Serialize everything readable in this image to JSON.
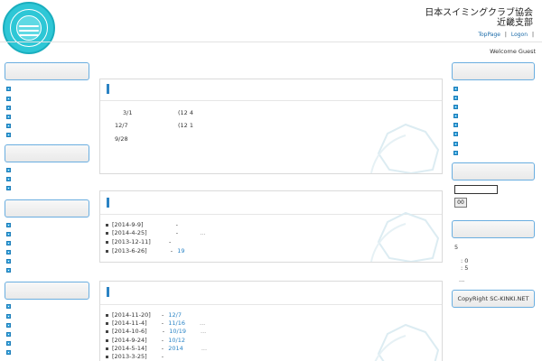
{
  "header": {
    "title_line1": "日本スイミングクラブ協会",
    "title_line2": "近畿支部",
    "links": [
      "TopPage",
      "Logon"
    ],
    "welcome": "Welcome Guest"
  },
  "panel1": {
    "rows": [
      {
        "date": "3/1",
        "tail": "(12 4"
      },
      {
        "date": "12/7",
        "tail": "(12 1"
      },
      {
        "date": "9/28",
        "tail": ""
      }
    ]
  },
  "panel2": {
    "items": [
      {
        "date": "[2014-9-9]",
        "sep": "-",
        "link": "",
        "more": ""
      },
      {
        "date": "[2014-4-25]",
        "sep": "-",
        "link": "",
        "more": "..."
      },
      {
        "date": "[2013-12-11]",
        "sep": "-",
        "link": "",
        "more": ""
      },
      {
        "date": "[2013-6-26]",
        "sep": "-",
        "link": "19",
        "more": ""
      }
    ]
  },
  "panel3": {
    "items": [
      {
        "date": "[2014-11-20]",
        "sep": "-",
        "link": "12/7",
        "more": ""
      },
      {
        "date": "[2014-11-4]",
        "sep": "-",
        "link": "11/16",
        "more": "..."
      },
      {
        "date": "[2014-10-6]",
        "sep": "-",
        "link": "10/19",
        "more": "..."
      },
      {
        "date": "[2014-9-24]",
        "sep": "-",
        "link": "10/12",
        "more": ""
      },
      {
        "date": "[2014-5-14]",
        "sep": "-",
        "link": "2014",
        "more": "..."
      },
      {
        "date": "[2013-3-25]",
        "sep": "-",
        "link": "",
        "more": ""
      }
    ]
  },
  "right": {
    "search_button": "00",
    "stat_main": "5",
    "stat_a": ": 0",
    "stat_b": ": 5",
    "stat_more": "...",
    "copyright": "CopyRight SC-KINKI.NET"
  },
  "colors": {
    "accent": "#2b83c4",
    "logo": "#2ec7d6",
    "widget_border": "#6aaee0"
  }
}
